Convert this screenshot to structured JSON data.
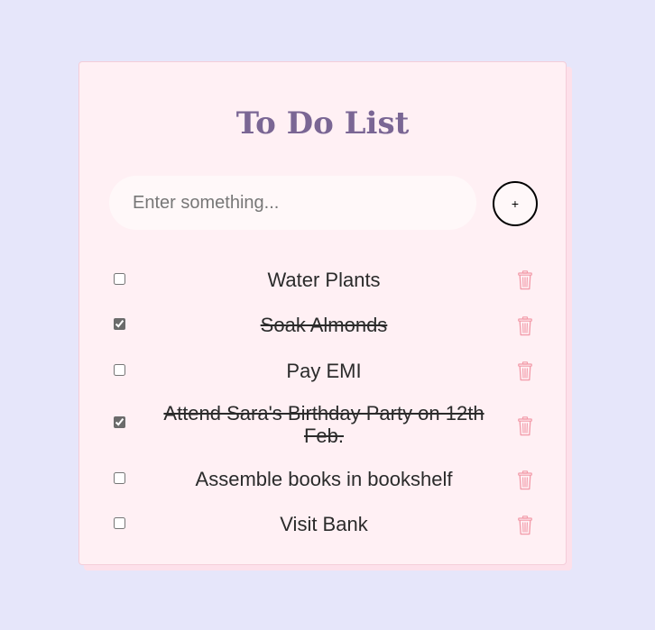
{
  "app": {
    "title": "To Do List"
  },
  "input": {
    "placeholder": "Enter something...",
    "value": ""
  },
  "add_button": {
    "label": "+"
  },
  "colors": {
    "background": "#e6e6fa",
    "card": "#fff0f4",
    "title": "#7a6694",
    "delete_icon": "#f29aa8"
  },
  "todos": [
    {
      "text": "Water Plants",
      "done": false
    },
    {
      "text": "Soak Almonds",
      "done": true
    },
    {
      "text": "Pay EMI",
      "done": false
    },
    {
      "text": "Attend Sara's Birthday Party on 12th Feb.",
      "done": true
    },
    {
      "text": "Assemble books in bookshelf",
      "done": false
    },
    {
      "text": "Visit Bank",
      "done": false
    }
  ],
  "icons": {
    "delete": "trash-icon"
  }
}
